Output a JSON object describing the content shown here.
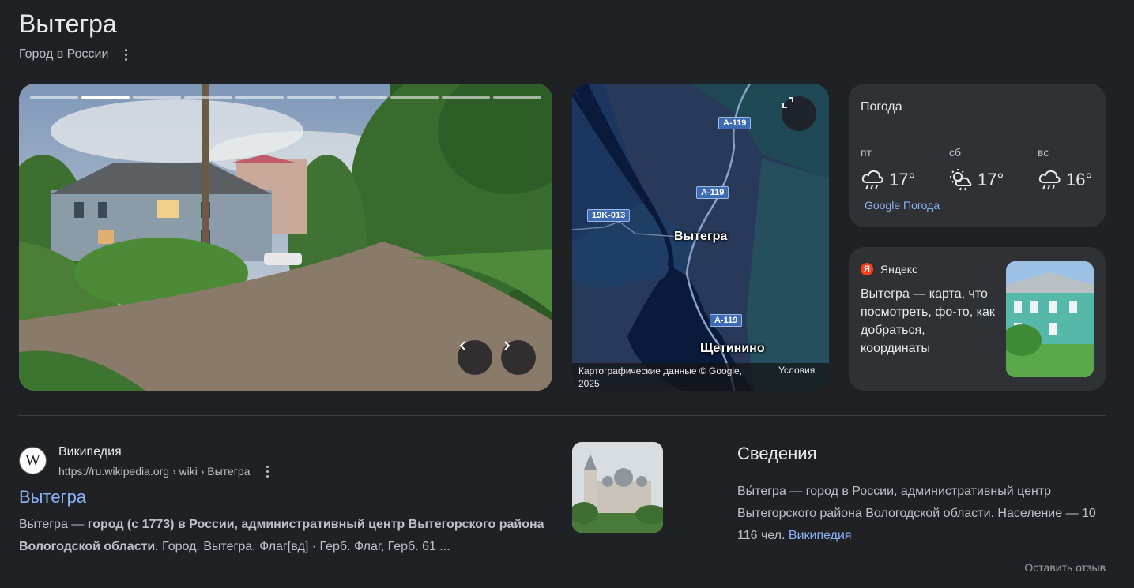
{
  "header": {
    "title": "Вытегра",
    "subtitle": "Город в России"
  },
  "photo": {
    "slide_count": 10,
    "active_slide": 2
  },
  "map": {
    "roads": [
      "A-119",
      "A-119",
      "A-119",
      "19K-013"
    ],
    "labels": [
      "Вытегра",
      "Щетинино"
    ],
    "copyright": "Картографические данные © Google, 2025",
    "terms": "Условия"
  },
  "weather": {
    "title": "Погода",
    "days": [
      {
        "name": "пт",
        "temp": "17°",
        "icon": "rain-cloud-icon"
      },
      {
        "name": "сб",
        "temp": "17°",
        "icon": "sun-cloud-rain-icon"
      },
      {
        "name": "вс",
        "temp": "16°",
        "icon": "rain-cloud-icon"
      }
    ],
    "source": "Google Погода"
  },
  "yandex": {
    "logo_letter": "Я",
    "name": "Яндекс",
    "text": "Вытегра — карта, что посмотреть, фо-то, как добраться, координаты"
  },
  "result": {
    "site": "Википедия",
    "url": "https://ru.wikipedia.org › wiki › Вытегра",
    "title": "Вытегра",
    "snippet_lead": "Вы́тегра — ",
    "snippet_bold": "город (с 1773) в России, административный центр Вытегорского района Вологодской области",
    "snippet_tail": ". Город. Вытегра. Флаг[вд] · Герб. Флаг, Герб. 61 ..."
  },
  "info": {
    "title": "Сведения",
    "text": "Вы́тегра — город в России, административный центр Вытегорского района Вологодской области. Население — 10 116 чел. ",
    "link": "Википедия",
    "feedback": "Оставить отзыв"
  },
  "colors": {
    "background": "#202124",
    "card": "#303134",
    "link": "#8ab4f8",
    "map_land": "#29395a",
    "map_water": "#0b1a3a"
  }
}
